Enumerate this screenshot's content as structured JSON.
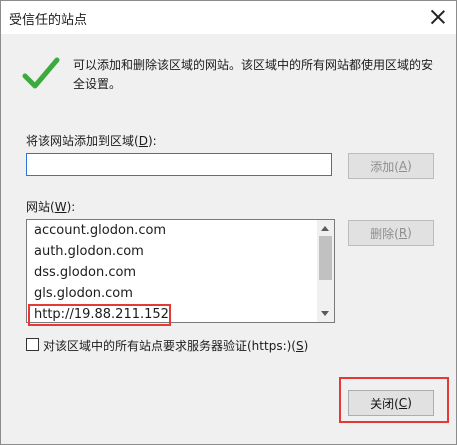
{
  "dialog": {
    "title": "受信任的站点",
    "info_text": "可以添加和删除该区域的网站。该区域中的所有网站都使用区域的安全设置。",
    "add_label_pre": "将该网站添加到区域(",
    "add_label_key": "D",
    "add_label_post": "):",
    "input_value": "",
    "add_button_pre": "添加(",
    "add_button_key": "A",
    "add_button_post": ")",
    "sites_label_pre": "网站(",
    "sites_label_key": "W",
    "sites_label_post": "):",
    "remove_button_pre": "删除(",
    "remove_button_key": "R",
    "remove_button_post": ")",
    "sites": [
      "account.glodon.com",
      "auth.glodon.com",
      "dss.glodon.com",
      "gls.glodon.com",
      "http://19.88.211.152"
    ],
    "https_label_pre": "对该区域中的所有站点要求服务器验证(https:)(",
    "https_label_key": "S",
    "https_label_post": ")",
    "https_checked": false,
    "close_button_pre": "关闭(",
    "close_button_key": "C",
    "close_button_post": ")"
  },
  "icons": {
    "check": "checkmark-icon",
    "close": "close-icon"
  },
  "colors": {
    "check_green": "#3caa3c",
    "highlight_red": "#e53935",
    "input_border": "#2e74d6"
  }
}
